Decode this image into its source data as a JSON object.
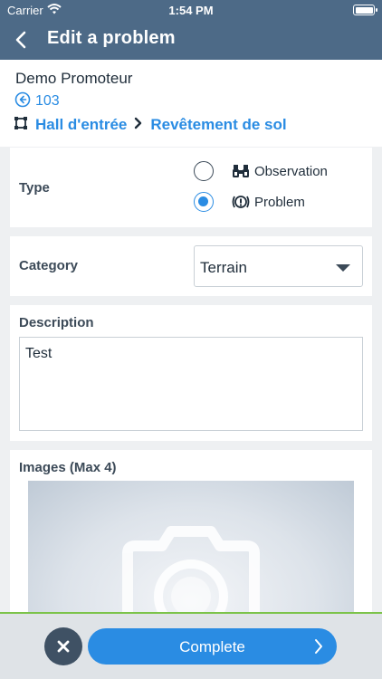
{
  "status_bar": {
    "carrier": "Carrier",
    "time": "1:54 PM"
  },
  "nav": {
    "title": "Edit a problem"
  },
  "header": {
    "project": "Demo Promoteur",
    "reference": "103",
    "breadcrumb": [
      "Hall d'entrée",
      "Revêtement de sol"
    ]
  },
  "type": {
    "label": "Type",
    "options": [
      {
        "label": "Observation",
        "icon": "binoculars-icon",
        "selected": false
      },
      {
        "label": "Problem",
        "icon": "alert-circle-icon",
        "selected": true
      }
    ]
  },
  "category": {
    "label": "Category",
    "value": "Terrain"
  },
  "description": {
    "label": "Description",
    "value": "Test"
  },
  "images": {
    "label": "Images (Max 4)"
  },
  "footer": {
    "complete_label": "Complete"
  },
  "colors": {
    "header": "#4d6a87",
    "accent": "#2a8ce3",
    "divider": "#7cc34a"
  }
}
